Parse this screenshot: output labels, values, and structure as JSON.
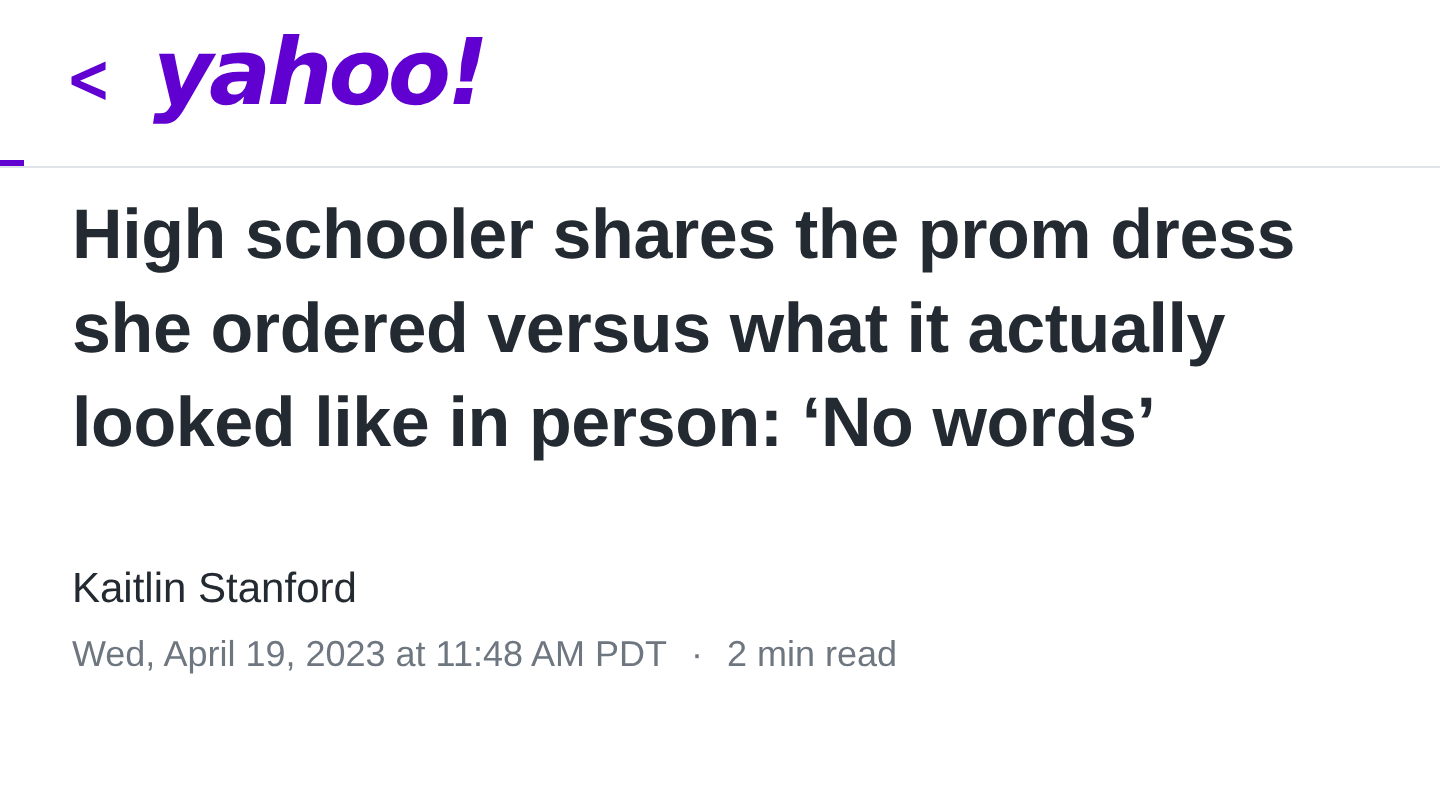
{
  "header": {
    "back": "<",
    "logo": "yahoo!"
  },
  "reading_progress": {
    "level": 0.016
  },
  "article": {
    "headline": "High schooler shares the prom dress she ordered versus what it actually looked like in person: ‘No words’",
    "author": "Kaitlin Stanford",
    "date": "Wed, April 19, 2023 at 11:48 AM PDT",
    "separator": "·",
    "read_time": "2 min read"
  }
}
